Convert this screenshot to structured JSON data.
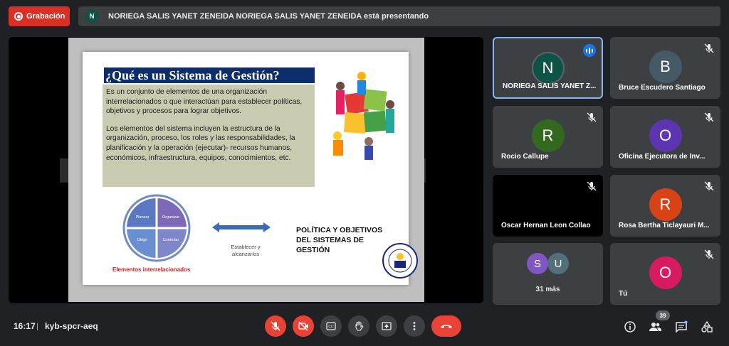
{
  "top": {
    "record_label": "Grabación",
    "presenter_initial": "N",
    "presenter_text": "NORIEGA SALIS YANET ZENEIDA NORIEGA SALIS YANET ZENEIDA está presentando"
  },
  "slide": {
    "title": "¿Qué es un Sistema de Gestión?",
    "para1": "Es un conjunto de elementos de una organización interrelacionados o que interactúan para establecer políticas, objetivos y procesos para lograr objetivos.",
    "para2": "Los elementos del sistema incluyen la estructura de la organización, proceso, los roles y las responsabilidades, la planificación y la operación (ejecutar)- recursos humanos, económicos,  infraestructura, equipos, conocimientos, etc.",
    "cycle": [
      "Planear",
      "Organizar",
      "Dirigir",
      "Controlar"
    ],
    "cycle_caption": "Elementos interrelacionados",
    "arrow_line1": "Establecer y",
    "arrow_line2": "alcanzarlos",
    "policy_line1": "POLÍTICA Y OBJETIVOS",
    "policy_line2": "DEL SISTEMAS DE",
    "policy_line3": "GESTIÓN"
  },
  "participants": [
    {
      "initial": "N",
      "name": "NORIEGA SALIS YANET Z...",
      "color": "#0b5345"
    },
    {
      "initial": "B",
      "name": "Bruce Escudero Santiago",
      "color": "#455a64"
    },
    {
      "initial": "R",
      "name": "Rocio Callupe",
      "color": "#33691e"
    },
    {
      "initial": "O",
      "name": "Oficina Ejecutora de Inv...",
      "color": "#5e35b1"
    },
    {
      "initial": "",
      "name": "Oscar Hernan Leon Collao",
      "color": "#000000"
    },
    {
      "initial": "R",
      "name": "Rosa Bertha Ticlayauri M...",
      "color": "#d84315"
    },
    {
      "initial": "O",
      "name": "Tú",
      "color": "#d81b60"
    }
  ],
  "more": {
    "initials": [
      "S",
      "U"
    ],
    "colors": [
      "#7e57c2",
      "#546e7a"
    ],
    "label": "31 más"
  },
  "bottom": {
    "time": "16:17",
    "code": "kyb-spcr-aeq",
    "participant_count": "39"
  },
  "colors": {
    "accent_red": "#ea4335",
    "tile_bg": "#3c4043",
    "active_border": "#8ab4f8"
  }
}
